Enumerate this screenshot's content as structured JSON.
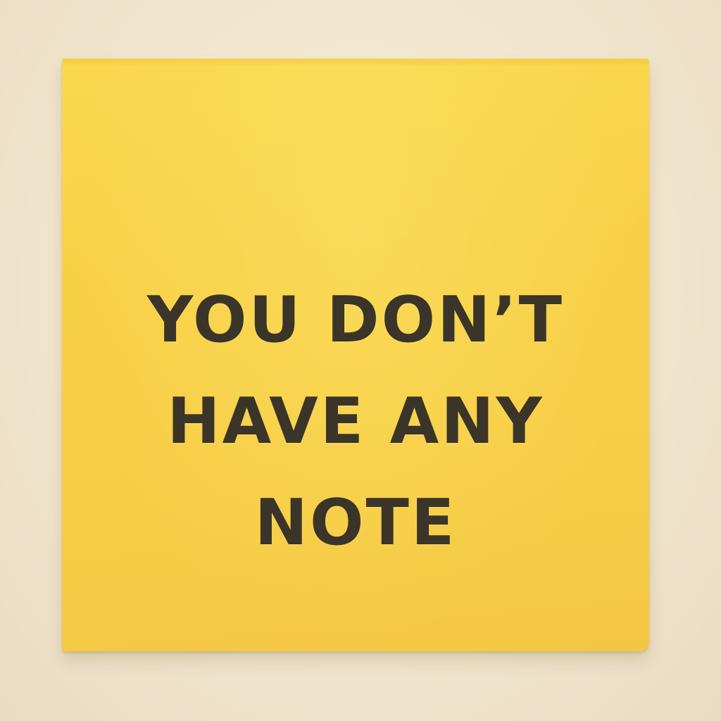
{
  "note": {
    "lines": [
      "YOU DON’T",
      "HAVE ANY",
      "NOTE"
    ]
  },
  "colors": {
    "background": "#f0e4cc",
    "note": "#f8d046",
    "text": "#3a3528"
  }
}
